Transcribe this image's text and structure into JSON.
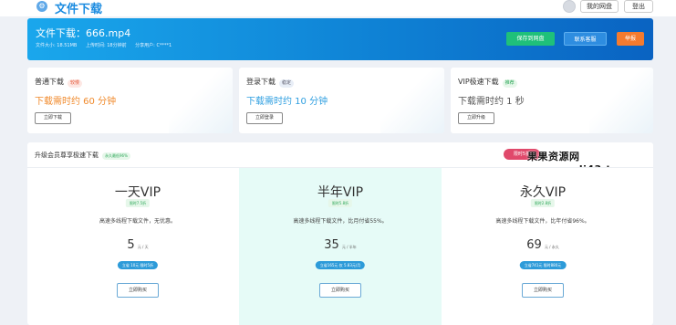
{
  "header": {
    "logo_icon": "gear-icon",
    "title": "文件下载",
    "avatar_icon": "user-avatar",
    "my_netdisk": "我的网盘",
    "logout": "登出"
  },
  "banner": {
    "title": "文件下载：666.mp4",
    "meta": [
      "文件大小: 18.51MB",
      "上传时间: 18分钟前",
      "分享用户: C****1"
    ],
    "buttons": {
      "save": "保存到网盘",
      "support": "联系客服",
      "report": "举报"
    },
    "colors": {
      "save": "#1fc07a",
      "support": "#2e8de0",
      "report": "#f47b2f"
    }
  },
  "cards": [
    {
      "name": "普通下载",
      "tag": "较慢",
      "time": "下载需时约 60 分钟",
      "button": "立即下载",
      "time_color": "#f08a2c",
      "tag_bg": "#fde7e3",
      "tag_color": "#e55b3c"
    },
    {
      "name": "登录下载",
      "tag": "稳定",
      "time": "下载需时约 10 分钟",
      "button": "立即登录",
      "time_color": "#2f9fe0",
      "tag_bg": "#e8eef7",
      "tag_color": "#556"
    },
    {
      "name": "VIP极速下载",
      "tag": "推荐",
      "time": "下载需时约 1 秒",
      "button": "立即升级",
      "time_color": "#555555",
      "tag_bg": "#e6f7ea",
      "tag_color": "#2fa85a"
    }
  ],
  "panel": {
    "title": "升级会员尊享极速下载",
    "tag": "永久最低96%",
    "badge": "限时5折",
    "watermark": "果果资源网www.ggdj43.top",
    "plans": [
      {
        "name": "一天VIP",
        "tag": "限时7.5折",
        "desc": "高速多线程下载文件，无优惠。",
        "price": "5",
        "unit": "元 / 天",
        "info": "立省 10元 限时5折",
        "button": "立即购买",
        "bg": "#ffffff"
      },
      {
        "name": "半年VIP",
        "tag": "限时5.8折",
        "desc": "高速多线程下载文件，比月付省55%。",
        "price": "35",
        "unit": "元 / 半年",
        "info": "立省165元 仅 5.83元/月",
        "button": "立即购买",
        "bg": "#e6fbf7"
      },
      {
        "name": "永久VIP",
        "tag": "限时2.8折",
        "desc": "高速多线程下载文件，比年付省96%。",
        "price": "69",
        "unit": "元 / 永久",
        "info": "立省741元 限时880元",
        "button": "立即购买",
        "bg": "#ffffff"
      }
    ]
  }
}
